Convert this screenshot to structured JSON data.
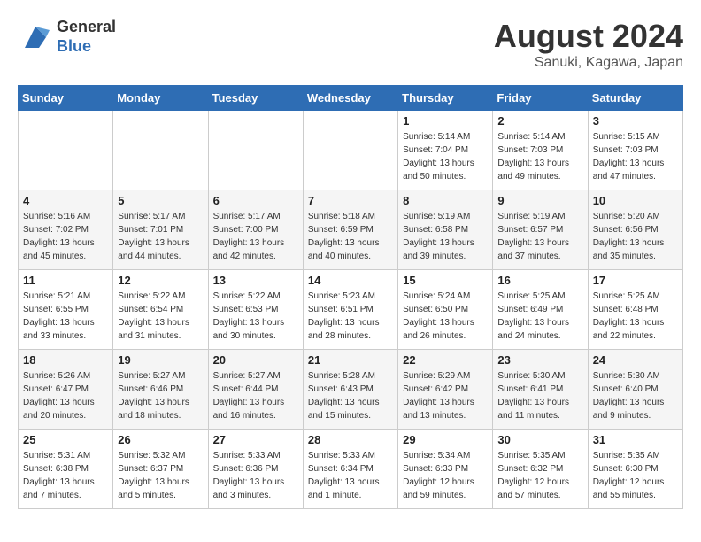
{
  "header": {
    "logo_line1": "General",
    "logo_line2": "Blue",
    "title": "August 2024",
    "subtitle": "Sanuki, Kagawa, Japan"
  },
  "weekdays": [
    "Sunday",
    "Monday",
    "Tuesday",
    "Wednesday",
    "Thursday",
    "Friday",
    "Saturday"
  ],
  "weeks": [
    [
      {
        "day": "",
        "info": ""
      },
      {
        "day": "",
        "info": ""
      },
      {
        "day": "",
        "info": ""
      },
      {
        "day": "",
        "info": ""
      },
      {
        "day": "1",
        "info": "Sunrise: 5:14 AM\nSunset: 7:04 PM\nDaylight: 13 hours\nand 50 minutes."
      },
      {
        "day": "2",
        "info": "Sunrise: 5:14 AM\nSunset: 7:03 PM\nDaylight: 13 hours\nand 49 minutes."
      },
      {
        "day": "3",
        "info": "Sunrise: 5:15 AM\nSunset: 7:03 PM\nDaylight: 13 hours\nand 47 minutes."
      }
    ],
    [
      {
        "day": "4",
        "info": "Sunrise: 5:16 AM\nSunset: 7:02 PM\nDaylight: 13 hours\nand 45 minutes."
      },
      {
        "day": "5",
        "info": "Sunrise: 5:17 AM\nSunset: 7:01 PM\nDaylight: 13 hours\nand 44 minutes."
      },
      {
        "day": "6",
        "info": "Sunrise: 5:17 AM\nSunset: 7:00 PM\nDaylight: 13 hours\nand 42 minutes."
      },
      {
        "day": "7",
        "info": "Sunrise: 5:18 AM\nSunset: 6:59 PM\nDaylight: 13 hours\nand 40 minutes."
      },
      {
        "day": "8",
        "info": "Sunrise: 5:19 AM\nSunset: 6:58 PM\nDaylight: 13 hours\nand 39 minutes."
      },
      {
        "day": "9",
        "info": "Sunrise: 5:19 AM\nSunset: 6:57 PM\nDaylight: 13 hours\nand 37 minutes."
      },
      {
        "day": "10",
        "info": "Sunrise: 5:20 AM\nSunset: 6:56 PM\nDaylight: 13 hours\nand 35 minutes."
      }
    ],
    [
      {
        "day": "11",
        "info": "Sunrise: 5:21 AM\nSunset: 6:55 PM\nDaylight: 13 hours\nand 33 minutes."
      },
      {
        "day": "12",
        "info": "Sunrise: 5:22 AM\nSunset: 6:54 PM\nDaylight: 13 hours\nand 31 minutes."
      },
      {
        "day": "13",
        "info": "Sunrise: 5:22 AM\nSunset: 6:53 PM\nDaylight: 13 hours\nand 30 minutes."
      },
      {
        "day": "14",
        "info": "Sunrise: 5:23 AM\nSunset: 6:51 PM\nDaylight: 13 hours\nand 28 minutes."
      },
      {
        "day": "15",
        "info": "Sunrise: 5:24 AM\nSunset: 6:50 PM\nDaylight: 13 hours\nand 26 minutes."
      },
      {
        "day": "16",
        "info": "Sunrise: 5:25 AM\nSunset: 6:49 PM\nDaylight: 13 hours\nand 24 minutes."
      },
      {
        "day": "17",
        "info": "Sunrise: 5:25 AM\nSunset: 6:48 PM\nDaylight: 13 hours\nand 22 minutes."
      }
    ],
    [
      {
        "day": "18",
        "info": "Sunrise: 5:26 AM\nSunset: 6:47 PM\nDaylight: 13 hours\nand 20 minutes."
      },
      {
        "day": "19",
        "info": "Sunrise: 5:27 AM\nSunset: 6:46 PM\nDaylight: 13 hours\nand 18 minutes."
      },
      {
        "day": "20",
        "info": "Sunrise: 5:27 AM\nSunset: 6:44 PM\nDaylight: 13 hours\nand 16 minutes."
      },
      {
        "day": "21",
        "info": "Sunrise: 5:28 AM\nSunset: 6:43 PM\nDaylight: 13 hours\nand 15 minutes."
      },
      {
        "day": "22",
        "info": "Sunrise: 5:29 AM\nSunset: 6:42 PM\nDaylight: 13 hours\nand 13 minutes."
      },
      {
        "day": "23",
        "info": "Sunrise: 5:30 AM\nSunset: 6:41 PM\nDaylight: 13 hours\nand 11 minutes."
      },
      {
        "day": "24",
        "info": "Sunrise: 5:30 AM\nSunset: 6:40 PM\nDaylight: 13 hours\nand 9 minutes."
      }
    ],
    [
      {
        "day": "25",
        "info": "Sunrise: 5:31 AM\nSunset: 6:38 PM\nDaylight: 13 hours\nand 7 minutes."
      },
      {
        "day": "26",
        "info": "Sunrise: 5:32 AM\nSunset: 6:37 PM\nDaylight: 13 hours\nand 5 minutes."
      },
      {
        "day": "27",
        "info": "Sunrise: 5:33 AM\nSunset: 6:36 PM\nDaylight: 13 hours\nand 3 minutes."
      },
      {
        "day": "28",
        "info": "Sunrise: 5:33 AM\nSunset: 6:34 PM\nDaylight: 13 hours\nand 1 minute."
      },
      {
        "day": "29",
        "info": "Sunrise: 5:34 AM\nSunset: 6:33 PM\nDaylight: 12 hours\nand 59 minutes."
      },
      {
        "day": "30",
        "info": "Sunrise: 5:35 AM\nSunset: 6:32 PM\nDaylight: 12 hours\nand 57 minutes."
      },
      {
        "day": "31",
        "info": "Sunrise: 5:35 AM\nSunset: 6:30 PM\nDaylight: 12 hours\nand 55 minutes."
      }
    ]
  ]
}
